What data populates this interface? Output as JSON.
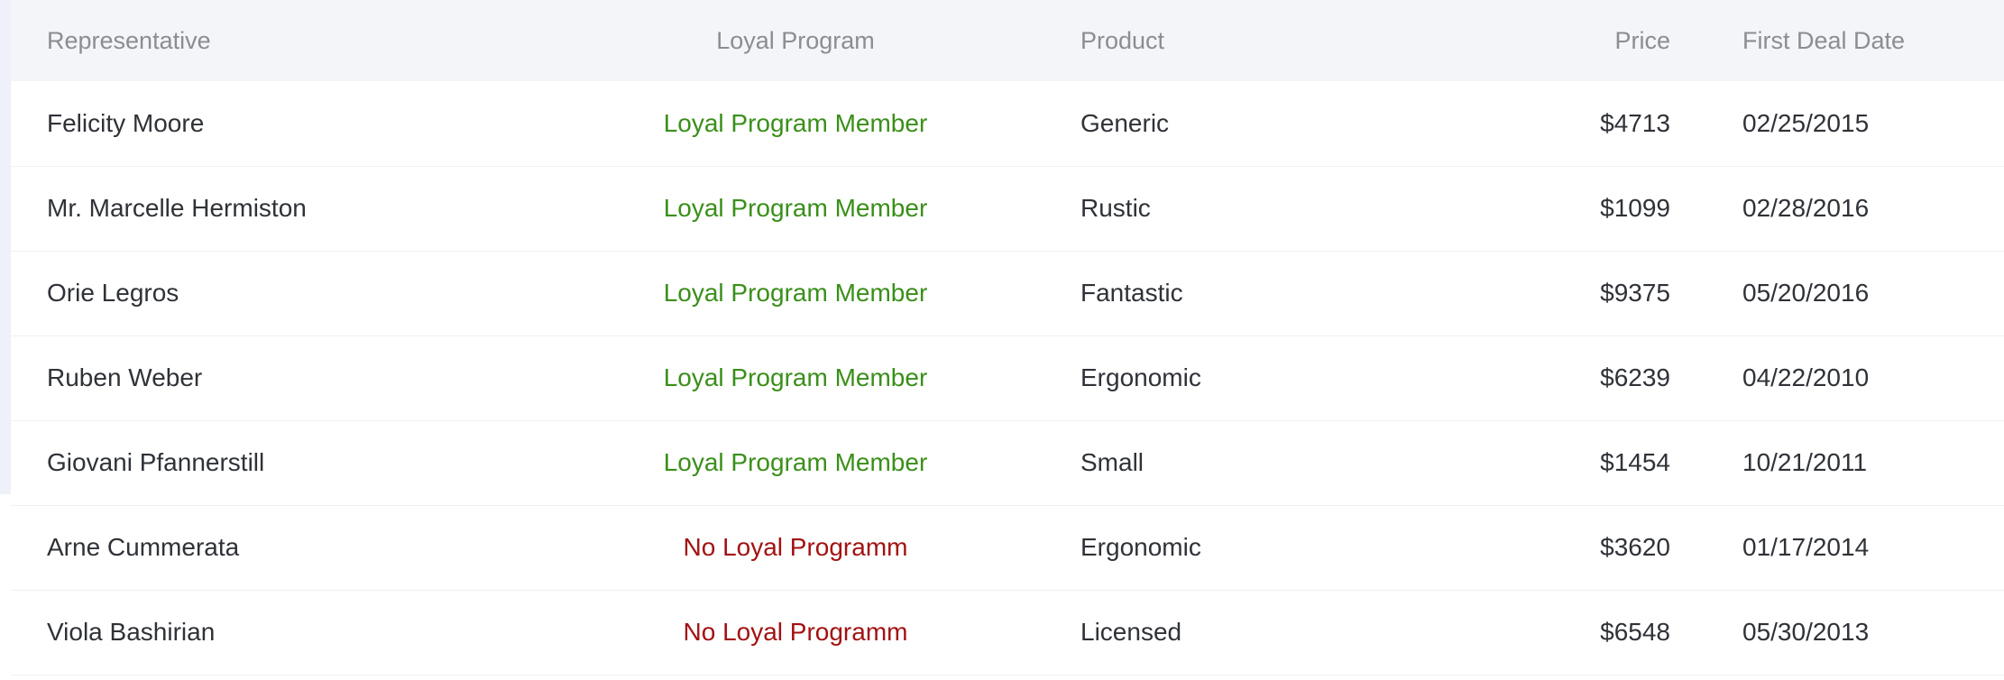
{
  "table": {
    "columns": {
      "representative": "Representative",
      "loyal": "Loyal Program",
      "product": "Product",
      "price": "Price",
      "date": "First Deal Date"
    },
    "rows": [
      {
        "representative": "Felicity Moore",
        "loyal": "Loyal Program Member",
        "product": "Generic",
        "price": "$4713",
        "date": "02/25/2015"
      },
      {
        "representative": "Mr. Marcelle Hermiston",
        "loyal": "Loyal Program Member",
        "product": "Rustic",
        "price": "$1099",
        "date": "02/28/2016"
      },
      {
        "representative": "Orie Legros",
        "loyal": "Loyal Program Member",
        "product": "Fantastic",
        "price": "$9375",
        "date": "05/20/2016"
      },
      {
        "representative": "Ruben Weber",
        "loyal": "Loyal Program Member",
        "product": "Ergonomic",
        "price": "$6239",
        "date": "04/22/2010"
      },
      {
        "representative": "Giovani Pfannerstill",
        "loyal": "Loyal Program Member",
        "product": "Small",
        "price": "$1454",
        "date": "10/21/2011"
      },
      {
        "representative": "Arne Cummerata",
        "loyal": "No Loyal Programm",
        "product": "Ergonomic",
        "price": "$3620",
        "date": "01/17/2014"
      },
      {
        "representative": "Viola Bashirian",
        "loyal": "No Loyal Programm",
        "product": "Licensed",
        "price": "$6548",
        "date": "05/30/2013"
      }
    ]
  },
  "colors": {
    "member": "#3a8f1a",
    "non_member": "#a31212",
    "header_bg": "#f3f5f8",
    "header_text": "#8a8d93",
    "body_text": "#2f3237"
  }
}
